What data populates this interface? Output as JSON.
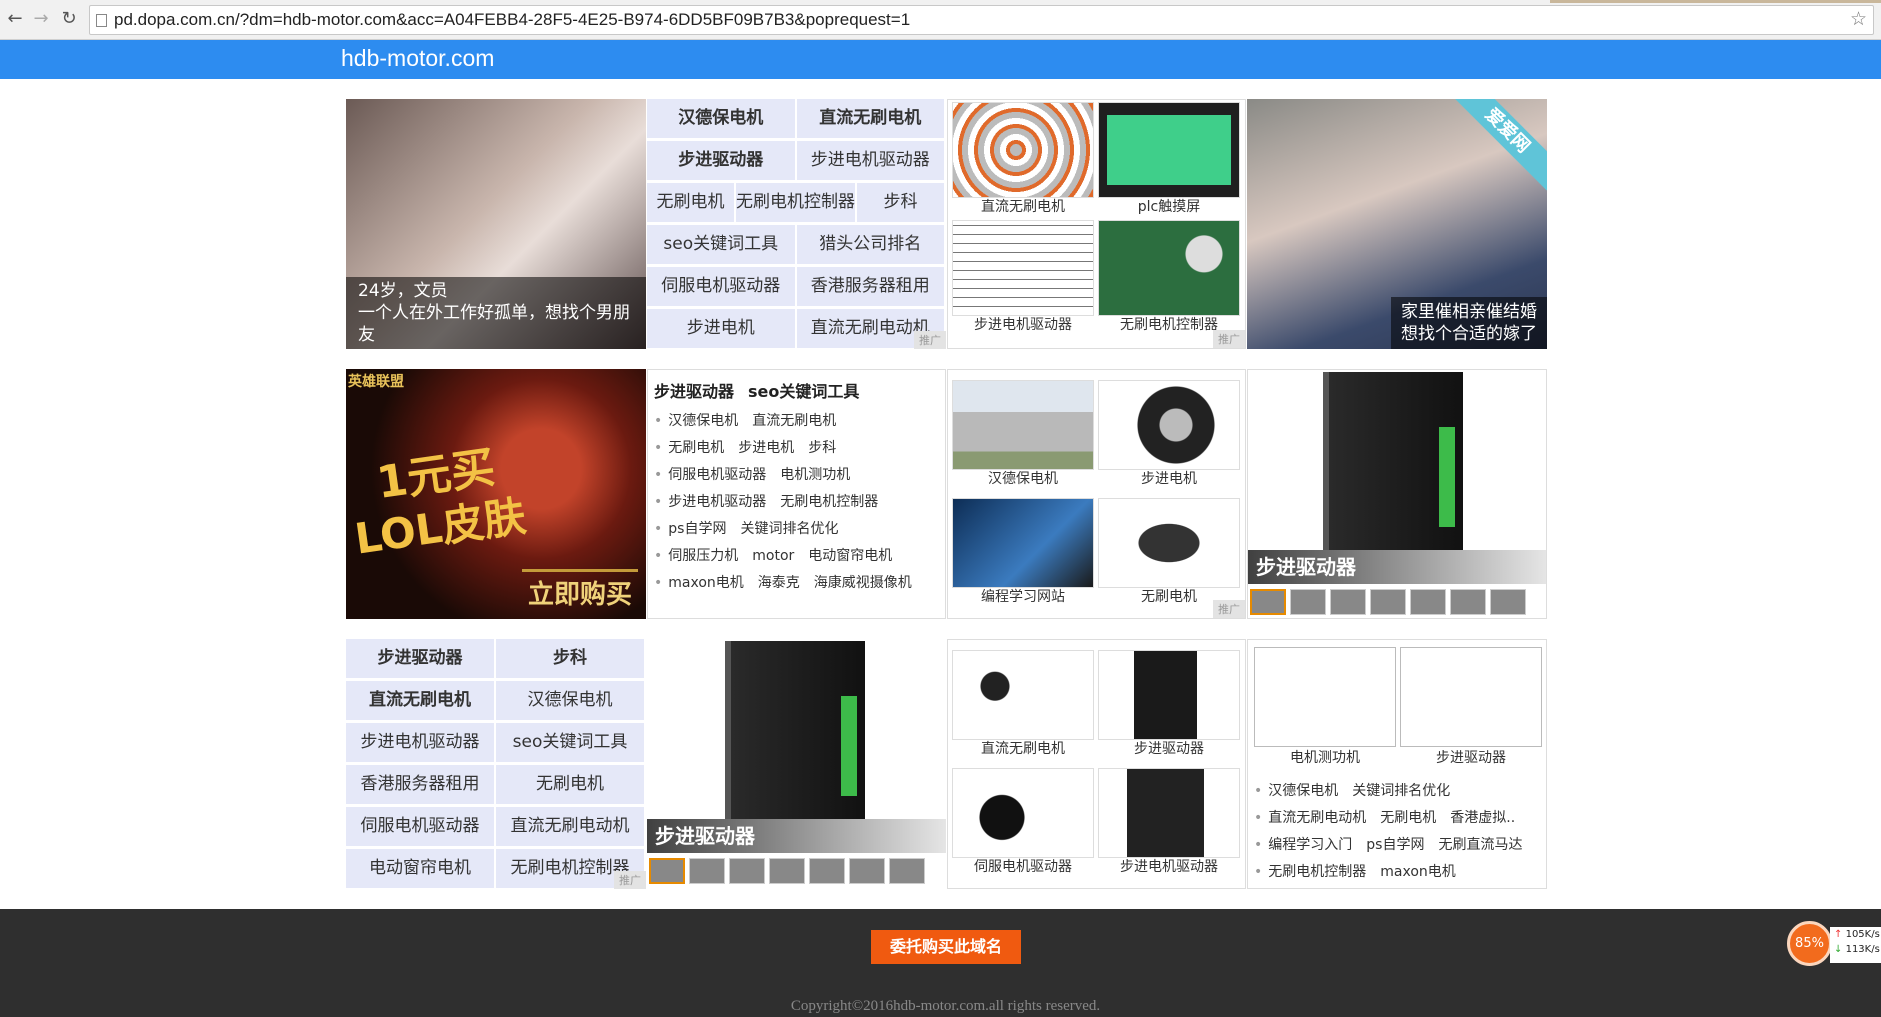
{
  "browser": {
    "url": "pd.dopa.com.cn/?dm=hdb-motor.com&acc=A04FEBB4-28F5-4E25-B974-6DD5BF09B7B3&poprequest=1",
    "back_icon": "back-arrow-icon",
    "forward_icon": "forward-arrow-icon",
    "reload_icon": "reload-icon",
    "bookmark_icon": "star-icon"
  },
  "site": {
    "title": "hdb-motor.com",
    "header_color": "#2d8cf0"
  },
  "row1": {
    "left_caption": {
      "line1": "24岁，文员",
      "line2": "一个人在外工作好孤单，想找个男朋友"
    },
    "keywords": [
      [
        {
          "t": "汉德保电机",
          "b": true
        },
        {
          "t": "直流无刷电机",
          "b": true
        }
      ],
      [
        {
          "t": "步进驱动器",
          "b": true
        },
        {
          "t": "步进电机驱动器",
          "b": false
        }
      ],
      [
        {
          "t": "无刷电机",
          "b": false
        },
        {
          "t": "无刷电机控制器",
          "b": false
        },
        {
          "t": "步科",
          "b": false
        }
      ],
      [
        {
          "t": "seo关键词工具",
          "b": false
        },
        {
          "t": "猎头公司排名",
          "b": false
        }
      ],
      [
        {
          "t": "伺服电机驱动器",
          "b": false
        },
        {
          "t": "香港服务器租用",
          "b": false
        }
      ],
      [
        {
          "t": "步进电机",
          "b": false
        },
        {
          "t": "直流无刷电动机",
          "b": false
        }
      ]
    ],
    "ad_tag": "推广",
    "thumbs": [
      "直流无刷电机",
      "plc触摸屏",
      "步进电机驱动器",
      "无刷电机控制器"
    ],
    "right_caption": {
      "line1": "家里催相亲催结婚",
      "line2": "想找个合适的嫁了"
    },
    "right_badge": "爱爱网"
  },
  "row2": {
    "promo": {
      "line1": "1元买",
      "line2": "LOL皮肤",
      "button": "立即购买",
      "brand": "英雄联盟"
    },
    "list_head": [
      "步进驱动器",
      "seo关键词工具"
    ],
    "list_rows": [
      [
        "汉德保电机",
        "直流无刷电机"
      ],
      [
        "无刷电机",
        "步进电机",
        "步科"
      ],
      [
        "伺服电机驱动器",
        "电机测功机"
      ],
      [
        "步进电机驱动器",
        "无刷电机控制器"
      ],
      [
        "ps自学网",
        "关键词排名优化"
      ],
      [
        "伺服压力机",
        "motor",
        "电动窗帘电机"
      ],
      [
        "maxon电机",
        "海泰克",
        "海康威视摄像机"
      ]
    ],
    "thumbs": [
      "汉德保电机",
      "步进电机",
      "编程学习网站",
      "无刷电机"
    ],
    "ad_tag": "推广",
    "feature_caption": "步进驱动器"
  },
  "row3": {
    "keywords": [
      [
        {
          "t": "步进驱动器",
          "b": true
        },
        {
          "t": "步科",
          "b": true
        }
      ],
      [
        {
          "t": "直流无刷电机",
          "b": true
        },
        {
          "t": "汉德保电机",
          "b": false
        }
      ],
      [
        {
          "t": "步进电机驱动器",
          "b": false
        },
        {
          "t": "seo关键词工具",
          "b": false
        }
      ],
      [
        {
          "t": "香港服务器租用",
          "b": false
        },
        {
          "t": "无刷电机",
          "b": false
        }
      ],
      [
        {
          "t": "伺服电机驱动器",
          "b": false
        },
        {
          "t": "直流无刷电动机",
          "b": false
        }
      ],
      [
        {
          "t": "电动窗帘电机",
          "b": false
        },
        {
          "t": "无刷电机控制器",
          "b": false
        }
      ]
    ],
    "ad_tag": "推广",
    "feature_caption": "步进驱动器",
    "thumbs": [
      "直流无刷电机",
      "步进驱动器",
      "伺服电机驱动器",
      "步进电机驱动器"
    ],
    "right_thumbs": [
      "电机测功机",
      "步进驱动器"
    ],
    "right_list": [
      [
        "汉德保电机",
        "关键词排名优化"
      ],
      [
        "直流无刷电动机",
        "无刷电机",
        "香港虚拟.."
      ],
      [
        "编程学习入门",
        "ps自学网",
        "无刷直流马达"
      ],
      [
        "无刷电机控制器",
        "maxon电机"
      ]
    ]
  },
  "footer": {
    "buy_button": "委托购买此域名",
    "copyright": "Copyright©2016hdb-motor.com.all rights reserved."
  },
  "speed_widget": {
    "percent": "85%",
    "up": "105K/s",
    "down": "113K/s"
  }
}
